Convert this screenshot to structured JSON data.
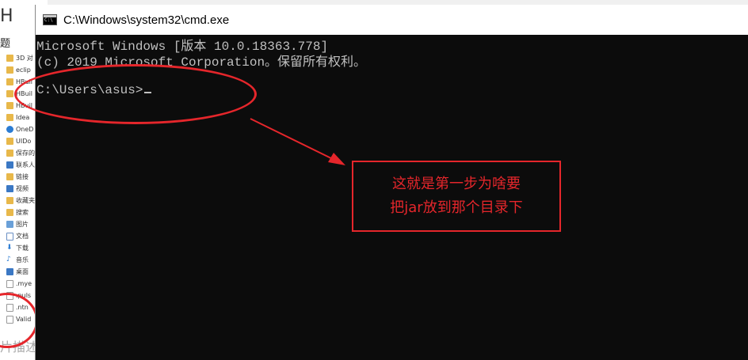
{
  "explorer": {
    "top_letter": "H",
    "top_label": "题",
    "nav_items": [
      {
        "label": "3D 对",
        "icon": "folder-icon"
      },
      {
        "label": "eclip",
        "icon": "folder-icon"
      },
      {
        "label": "HBuil",
        "icon": "folder-icon"
      },
      {
        "label": "HBuil",
        "icon": "folder-icon"
      },
      {
        "label": "HBuil",
        "icon": "folder-icon"
      },
      {
        "label": "Idea",
        "icon": "folder-icon"
      },
      {
        "label": "OneD",
        "icon": "cloud-icon"
      },
      {
        "label": "UIDo",
        "icon": "folder-icon"
      },
      {
        "label": "保存的",
        "icon": "folder-icon"
      },
      {
        "label": "联系人",
        "icon": "contacts-icon"
      },
      {
        "label": "链接",
        "icon": "link-icon"
      },
      {
        "label": "视频",
        "icon": "video-icon"
      },
      {
        "label": "收藏夹",
        "icon": "star-icon"
      },
      {
        "label": "搜索",
        "icon": "search-icon"
      },
      {
        "label": "图片",
        "icon": "image-icon"
      },
      {
        "label": "文档",
        "icon": "document-icon"
      },
      {
        "label": "下载",
        "icon": "download-icon"
      },
      {
        "label": "音乐",
        "icon": "music-icon"
      },
      {
        "label": "桌面",
        "icon": "desktop-icon"
      },
      {
        "label": ".mye",
        "icon": "file-icon"
      },
      {
        "label": ".puls",
        "icon": "file-icon"
      },
      {
        "label": ".ntn",
        "icon": "file-icon"
      },
      {
        "label": "Valid",
        "icon": "file-icon"
      }
    ],
    "bottom_text": "片描述"
  },
  "cmd": {
    "title": "C:\\Windows\\system32\\cmd.exe",
    "lines": [
      "Microsoft Windows [版本 10.0.18363.778]",
      "(c) 2019 Microsoft Corporation。保留所有权利。",
      "C:\\Users\\asus>"
    ]
  },
  "annotation": {
    "note_line1": "这就是第一步为啥要",
    "note_line2": "把jar放到那个目录下",
    "color": "#e5262b"
  },
  "colors": {
    "console_bg": "#0c0c0c",
    "console_text": "#c0c0c0",
    "annotation_red": "#e5262b"
  }
}
